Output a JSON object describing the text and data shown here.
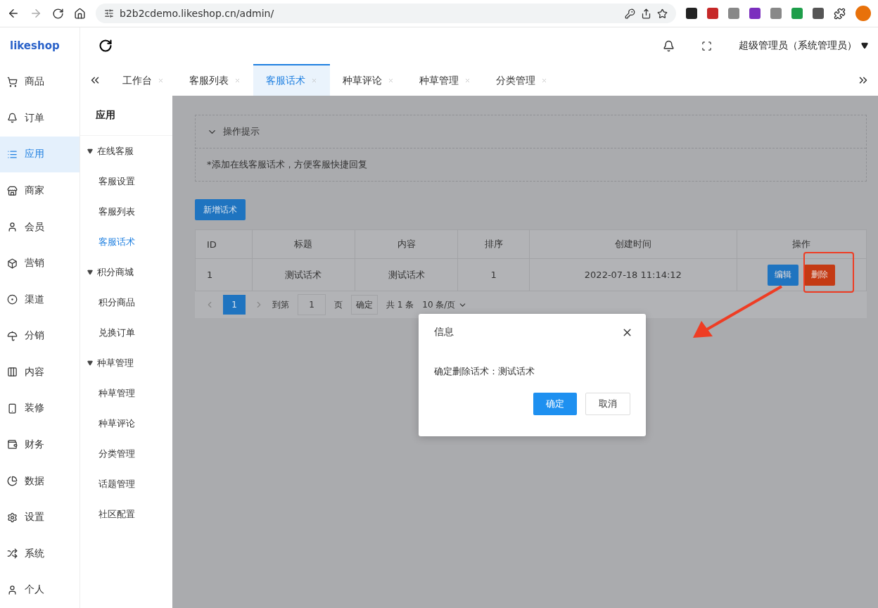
{
  "browser": {
    "url": "b2b2cdemo.likeshop.cn/admin/"
  },
  "header": {
    "logo": "likeshop",
    "user": "超级管理员（系统管理员）"
  },
  "sidebar": {
    "items": [
      {
        "label": "商品",
        "selected": false
      },
      {
        "label": "订单",
        "selected": false
      },
      {
        "label": "应用",
        "selected": true
      },
      {
        "label": "商家",
        "selected": false
      },
      {
        "label": "会员",
        "selected": false
      },
      {
        "label": "营销",
        "selected": false
      },
      {
        "label": "渠道",
        "selected": false
      },
      {
        "label": "分销",
        "selected": false
      },
      {
        "label": "内容",
        "selected": false
      },
      {
        "label": "装修",
        "selected": false
      },
      {
        "label": "财务",
        "selected": false
      },
      {
        "label": "数据",
        "selected": false
      },
      {
        "label": "设置",
        "selected": false
      },
      {
        "label": "系统",
        "selected": false
      },
      {
        "label": "个人",
        "selected": false
      }
    ]
  },
  "subnav": {
    "title": "应用",
    "groups": [
      {
        "label": "在线客服",
        "expanded": true,
        "children": [
          {
            "label": "客服设置",
            "selected": false
          },
          {
            "label": "客服列表",
            "selected": false
          },
          {
            "label": "客服话术",
            "selected": true
          }
        ]
      },
      {
        "label": "积分商城",
        "expanded": true,
        "children": [
          {
            "label": "积分商品",
            "selected": false
          },
          {
            "label": "兑换订单",
            "selected": false
          }
        ]
      },
      {
        "label": "种草管理",
        "expanded": true,
        "children": [
          {
            "label": "种草管理",
            "selected": false
          },
          {
            "label": "种草评论",
            "selected": false
          },
          {
            "label": "分类管理",
            "selected": false
          },
          {
            "label": "话题管理",
            "selected": false
          },
          {
            "label": "社区配置",
            "selected": false
          }
        ]
      }
    ]
  },
  "tabs": [
    {
      "label": "工作台",
      "selected": false
    },
    {
      "label": "客服列表",
      "selected": false
    },
    {
      "label": "客服话术",
      "selected": true
    },
    {
      "label": "种草评论",
      "selected": false
    },
    {
      "label": "种草管理",
      "selected": false
    },
    {
      "label": "分类管理",
      "selected": false
    }
  ],
  "tips": {
    "title": "操作提示",
    "expanded": true,
    "text": "*添加在线客服话术，方便客服快捷回复"
  },
  "add_button": "新增话术",
  "table": {
    "columns": [
      "ID",
      "标题",
      "内容",
      "排序",
      "创建时间",
      "操作"
    ],
    "rows": [
      {
        "cells": [
          "1",
          "测试话术",
          "测试话术",
          "1",
          "2022-07-18 11:14:12"
        ],
        "actions": [
          "编辑",
          "删除"
        ]
      }
    ]
  },
  "pagination": {
    "pages": [
      {
        "label": "1",
        "selected": true
      }
    ],
    "goto_label": "到第",
    "goto_value": "1",
    "page_unit": "页",
    "confirm": "确定",
    "total": "共 1 条",
    "page_size": "10 条/页"
  },
  "dialog": {
    "title": "信息",
    "message": "确定删除话术：测试话术",
    "buttons": [
      {
        "label": "确定",
        "kind": "primary"
      },
      {
        "label": "取消",
        "kind": "plain"
      }
    ]
  },
  "annotation": {
    "highlight": true,
    "arrow": true
  }
}
